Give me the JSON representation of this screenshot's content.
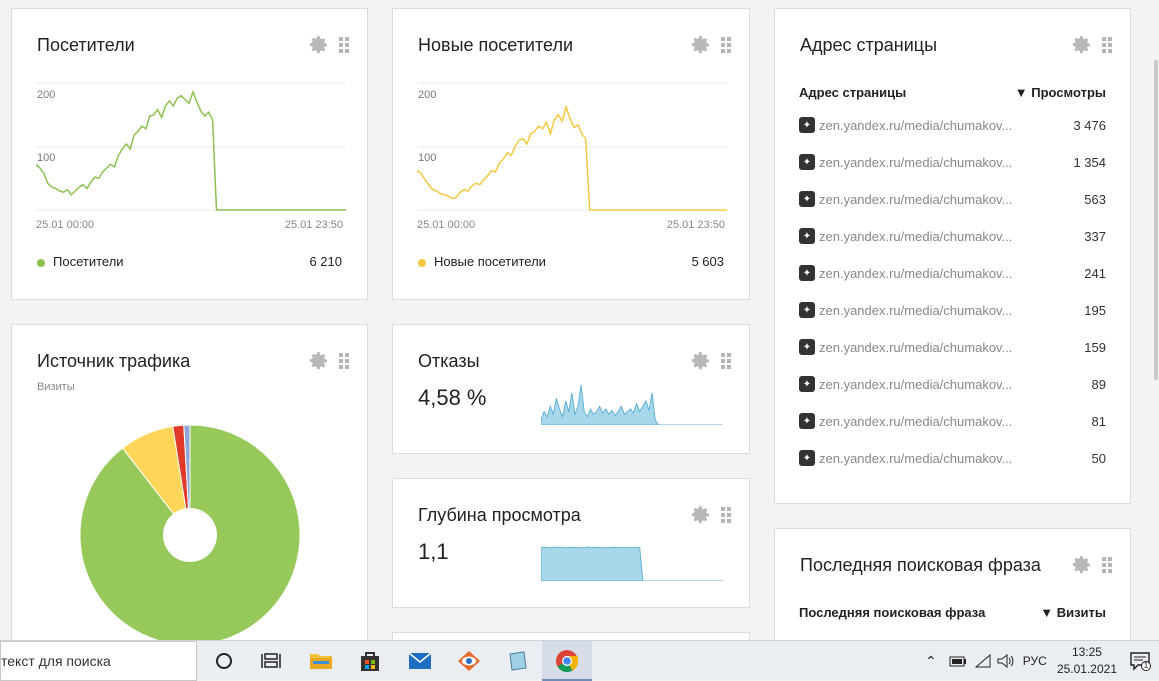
{
  "visitors": {
    "title": "Посетители",
    "y_ticks": [
      "200",
      "100"
    ],
    "x_start": "25.01 00:00",
    "x_end": "25.01 23:50",
    "legend_label": "Посетители",
    "legend_value": "6 210",
    "color": "#8cc152"
  },
  "new_visitors": {
    "title": "Новые посетители",
    "y_ticks": [
      "200",
      "100"
    ],
    "x_start": "25.01 00:00",
    "x_end": "25.01 23:50",
    "legend_label": "Новые посетители",
    "legend_value": "5 603",
    "color": "#f5c842"
  },
  "traffic": {
    "title": "Источник трафика",
    "subtitle": "Визиты"
  },
  "bounces": {
    "title": "Отказы",
    "value": "4,58 %"
  },
  "depth": {
    "title": "Глубина просмотра",
    "value": "1,1"
  },
  "pages": {
    "title": "Адрес страницы",
    "col_url": "Адрес страницы",
    "col_views": "▼ Просмотры",
    "rows": [
      {
        "url": "zen.yandex.ru/media/chumakov...",
        "views": "3 476"
      },
      {
        "url": "zen.yandex.ru/media/chumakov...",
        "views": "1 354"
      },
      {
        "url": "zen.yandex.ru/media/chumakov...",
        "views": "563"
      },
      {
        "url": "zen.yandex.ru/media/chumakov...",
        "views": "337"
      },
      {
        "url": "zen.yandex.ru/media/chumakov...",
        "views": "241"
      },
      {
        "url": "zen.yandex.ru/media/chumakov...",
        "views": "195"
      },
      {
        "url": "zen.yandex.ru/media/chumakov...",
        "views": "159"
      },
      {
        "url": "zen.yandex.ru/media/chumakov...",
        "views": "89"
      },
      {
        "url": "zen.yandex.ru/media/chumakov...",
        "views": "81"
      },
      {
        "url": "zen.yandex.ru/media/chumakov...",
        "views": "50"
      }
    ]
  },
  "search_phrase": {
    "title": "Последняя поисковая фраза",
    "col_phrase": "Последняя поисковая фраза",
    "col_visits": "▼ Визиты"
  },
  "taskbar": {
    "search_text": "текст для поиска",
    "lang": "РУС",
    "time": "13:25",
    "date": "25.01.2021",
    "notif_count": "1"
  },
  "chart_data": [
    {
      "type": "line",
      "title": "Посетители",
      "x": [
        "25.01 00:00",
        "25.01 23:50"
      ],
      "ylim": [
        0,
        200
      ],
      "series": [
        {
          "name": "Посетители",
          "total": 6210,
          "values": [
            72,
            66,
            58,
            42,
            36,
            34,
            30,
            28,
            32,
            24,
            30,
            36,
            40,
            34,
            44,
            52,
            50,
            60,
            66,
            72,
            68,
            86,
            96,
            104,
            96,
            118,
            124,
            132,
            128,
            148,
            150,
            158,
            146,
            164,
            172,
            164,
            176,
            180,
            174,
            168,
            186,
            170,
            156,
            148,
            154,
            142,
            0,
            0,
            0,
            0,
            0,
            0,
            0,
            0,
            0,
            0,
            0,
            0,
            0,
            0,
            0,
            0,
            0,
            0,
            0,
            0,
            0,
            0,
            0,
            0,
            0,
            0,
            0,
            0,
            0,
            0,
            0,
            0,
            0,
            0
          ]
        }
      ]
    },
    {
      "type": "line",
      "title": "Новые посетители",
      "x": [
        "25.01 00:00",
        "25.01 23:50"
      ],
      "ylim": [
        0,
        200
      ],
      "series": [
        {
          "name": "Новые посетители",
          "total": 5603,
          "values": [
            62,
            58,
            48,
            40,
            32,
            30,
            26,
            24,
            22,
            18,
            20,
            28,
            32,
            30,
            38,
            42,
            40,
            48,
            54,
            62,
            60,
            74,
            80,
            90,
            86,
            100,
            110,
            112,
            104,
            120,
            124,
            132,
            128,
            138,
            120,
            142,
            150,
            140,
            162,
            144,
            130,
            134,
            120,
            112,
            0,
            0,
            0,
            0,
            0,
            0,
            0,
            0,
            0,
            0,
            0,
            0,
            0,
            0,
            0,
            0,
            0,
            0,
            0,
            0,
            0,
            0,
            0,
            0,
            0,
            0,
            0,
            0,
            0,
            0,
            0,
            0,
            0,
            0,
            0,
            0
          ]
        }
      ]
    },
    {
      "type": "pie",
      "title": "Источник трафика",
      "slices": [
        {
          "value": 89.5,
          "color": "#96c85a"
        },
        {
          "value": 8.0,
          "color": "#ffd659"
        },
        {
          "value": 1.6,
          "color": "#e0392a"
        },
        {
          "value": 0.9,
          "color": "#8fa8d8"
        }
      ]
    },
    {
      "type": "area",
      "title": "Отказы",
      "series": [
        {
          "values": [
            4,
            10,
            6,
            14,
            8,
            20,
            12,
            6,
            18,
            10,
            24,
            8,
            14,
            30,
            10,
            6,
            12,
            8,
            10,
            14,
            9,
            12,
            8,
            11,
            7,
            10,
            14,
            8,
            10,
            12,
            9,
            16,
            10,
            14,
            18,
            11,
            24,
            4,
            0,
            0,
            0,
            0,
            0,
            0,
            0,
            0,
            0,
            0,
            0,
            0,
            0,
            0,
            0,
            0,
            0,
            0,
            0,
            0,
            0,
            0
          ]
        }
      ]
    },
    {
      "type": "area",
      "title": "Глубина просмотра",
      "series": [
        {
          "values": [
            1.1,
            1.12,
            1.1,
            1.09,
            1.11,
            1.1,
            1.12,
            1.1,
            1.09,
            1.1,
            1.11,
            1.1,
            1.1,
            1.09,
            1.1,
            1.12,
            1.1,
            1.1,
            1.11,
            1.1,
            1.1,
            1.09,
            1.1,
            1.1,
            1.11,
            1.1,
            1.1,
            1.1,
            1.1,
            1.1,
            1.1,
            1.1,
            1.1,
            0,
            0,
            0,
            0,
            0,
            0,
            0,
            0,
            0,
            0,
            0,
            0,
            0,
            0,
            0,
            0,
            0,
            0,
            0,
            0,
            0,
            0,
            0,
            0,
            0,
            0,
            0
          ]
        }
      ]
    }
  ]
}
